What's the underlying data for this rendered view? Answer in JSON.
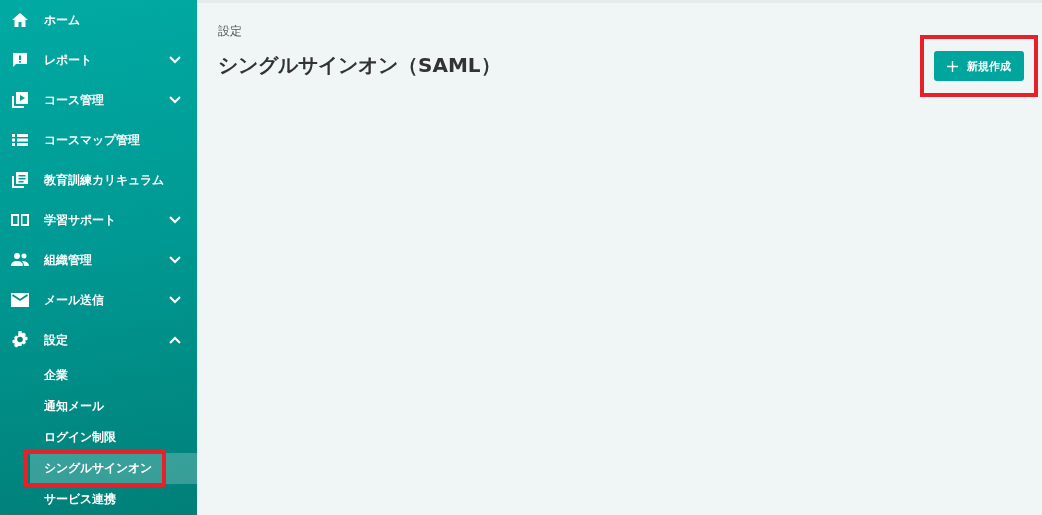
{
  "sidebar": {
    "items": [
      {
        "label": "ホーム"
      },
      {
        "label": "レポート",
        "expanded": false
      },
      {
        "label": "コース管理",
        "expanded": false
      },
      {
        "label": "コースマップ管理"
      },
      {
        "label": "教育訓練カリキュラム"
      },
      {
        "label": "学習サポート",
        "expanded": false
      },
      {
        "label": "組織管理",
        "expanded": false
      },
      {
        "label": "メール送信",
        "expanded": false
      },
      {
        "label": "設定",
        "expanded": true,
        "children": [
          {
            "label": "企業",
            "selected": false,
            "highlighted": false
          },
          {
            "label": "通知メール",
            "selected": false,
            "highlighted": false
          },
          {
            "label": "ログイン制限",
            "selected": false,
            "highlighted": false
          },
          {
            "label": "シングルサインオン",
            "selected": true,
            "highlighted": true
          },
          {
            "label": "サービス連携",
            "selected": false,
            "highlighted": false
          }
        ]
      }
    ]
  },
  "main": {
    "breadcrumb": "設定",
    "title": "シングルサインオン（SAML）",
    "new_button": {
      "label": "新規作成",
      "highlighted": true
    }
  }
}
